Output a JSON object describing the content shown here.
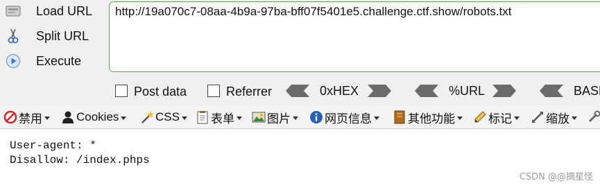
{
  "hackbar": {
    "buttons": [
      {
        "label": "Load URL",
        "icon": "load-url-icon"
      },
      {
        "label": "Split URL",
        "icon": "scissors-icon"
      },
      {
        "label": "Execute",
        "icon": "play-icon"
      }
    ],
    "url": "http://19a070c7-08aa-4b9a-97ba-bff07f5401e5.challenge.ctf.show/robots.txt",
    "options": {
      "post_data_label": "Post data",
      "referrer_label": "Referrer",
      "post_data_checked": false,
      "referrer_checked": false
    },
    "operations": [
      "0xHEX",
      "%URL",
      "BASE"
    ]
  },
  "toolbar": {
    "items": [
      {
        "label": "禁用",
        "icon": "disable-icon"
      },
      {
        "label": "Cookies",
        "icon": "cookies-icon"
      },
      {
        "label": "CSS",
        "icon": "css-wand-icon"
      },
      {
        "label": "表单",
        "icon": "form-icon"
      },
      {
        "label": "图片",
        "icon": "image-icon"
      },
      {
        "label": "网页信息",
        "icon": "info-icon"
      },
      {
        "label": "其他功能",
        "icon": "misc-icon"
      },
      {
        "label": "标记",
        "icon": "pencil-icon"
      },
      {
        "label": "缩放",
        "icon": "zoom-icon"
      }
    ]
  },
  "content": {
    "lines": [
      "User-agent: *",
      "Disallow: /index.phps"
    ]
  },
  "watermark": "CSDN @@摘星怪",
  "colors": {
    "url_border": "#5eaa55",
    "background": "#f0f0f0"
  }
}
